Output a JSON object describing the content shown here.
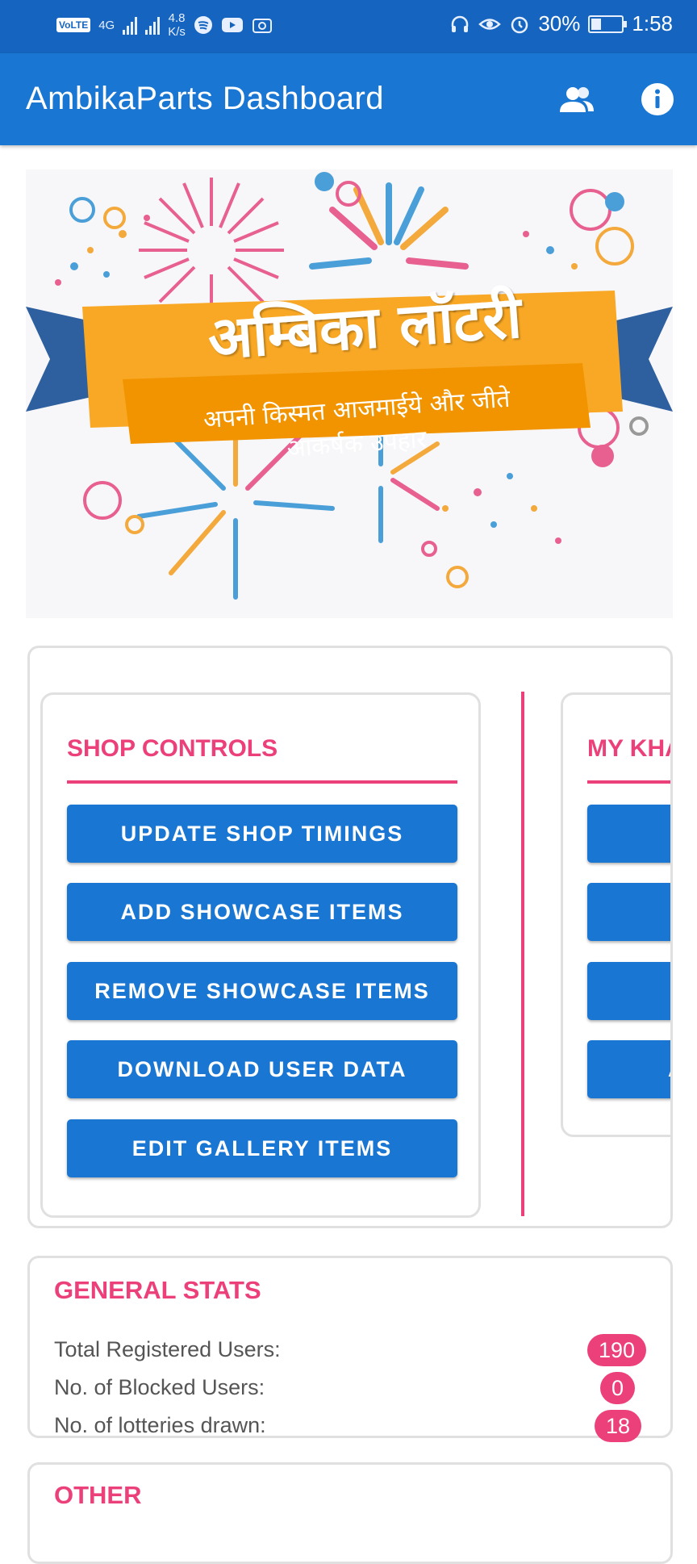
{
  "status_bar": {
    "network_badge": "VoLTE",
    "network_type": "4G",
    "speed_value": "4.8",
    "speed_unit": "K/s",
    "battery_percent": "30%",
    "time": "1:58"
  },
  "app_bar": {
    "title": "AmbikaParts Dashboard",
    "icons": [
      "users-icon",
      "info-icon"
    ]
  },
  "banner": {
    "title": "अम्बिका लॉटरी",
    "subtitle_line1": "अपनी किस्मत आजमाईये और जीते",
    "subtitle_line2": "आकर्षक उपहार"
  },
  "shop_controls": {
    "title": "SHOP CONTROLS",
    "buttons": [
      {
        "label": "UPDATE SHOP TIMINGS"
      },
      {
        "label": "ADD SHOWCASE ITEMS"
      },
      {
        "label": "REMOVE SHOWCASE ITEMS"
      },
      {
        "label": "DOWNLOAD USER DATA"
      },
      {
        "label": "EDIT GALLERY ITEMS"
      }
    ]
  },
  "my_panel": {
    "title": "MY KHA",
    "buttons": [
      {
        "label": ""
      },
      {
        "label": ""
      },
      {
        "label": ""
      },
      {
        "label": "A"
      }
    ]
  },
  "general_stats": {
    "title": "GENERAL STATS",
    "rows": [
      {
        "label": "Total Registered Users:",
        "value": "190"
      },
      {
        "label": "No. of Blocked Users:",
        "value": "0"
      },
      {
        "label": "No. of lotteries drawn:",
        "value": "18"
      }
    ]
  },
  "other": {
    "title": "OTHER"
  },
  "colors": {
    "primary": "#1976d2",
    "status_bar": "#1565c0",
    "accent": "#ec407a",
    "banner_ribbon": "#f9a825",
    "banner_ribbon_tail": "#2e5f9e"
  }
}
